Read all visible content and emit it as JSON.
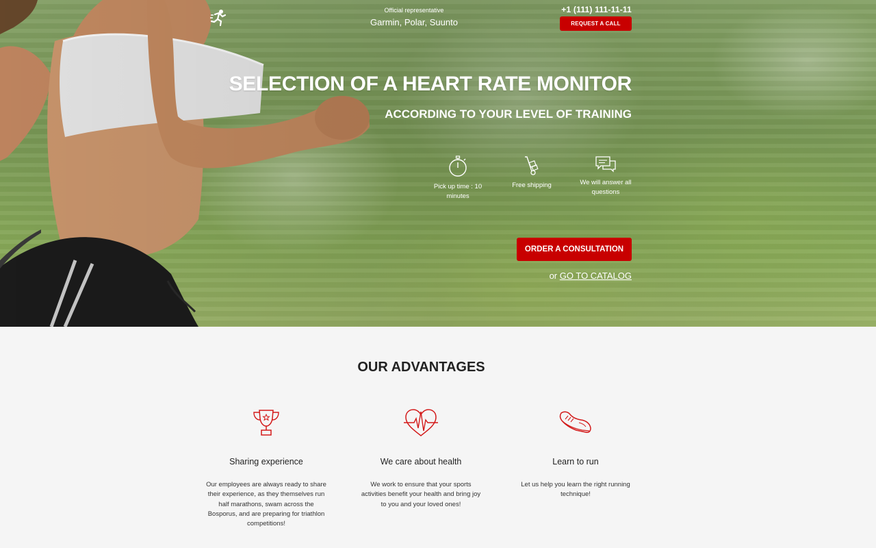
{
  "header": {
    "logo_icon": "runner-logo-icon",
    "representative_label": "Official representative",
    "brands": "Garmin, Polar, Suunto",
    "phone": "+1 (111) 111-11-11",
    "request_call_label": "Request a call"
  },
  "hero": {
    "title": "SELECTION OF A HEART RATE MONITOR",
    "subtitle": "ACCORDING TO YOUR LEVEL OF TRAINING",
    "features": [
      {
        "icon": "stopwatch-icon",
        "label": "Pick up time : 10 minutes"
      },
      {
        "icon": "hand-truck-icon",
        "label": "Free shipping"
      },
      {
        "icon": "chat-bubbles-icon",
        "label": "We will answer all questions"
      }
    ],
    "order_label": "Order a consultation",
    "or_label": "or",
    "catalog_label": "Go to catalog"
  },
  "advantages": {
    "title": "OUR ADVANTAGES",
    "items": [
      {
        "icon": "trophy-icon",
        "title": "Sharing experience",
        "text": "Our employees are always ready to share their experience, as they themselves run half marathons, swam across the Bosporus, and are preparing for triathlon competitions!"
      },
      {
        "icon": "heart-pulse-icon",
        "title": "We care about health",
        "text": "We work to ensure that your sports activities benefit your health and bring joy to you and your loved ones!"
      },
      {
        "icon": "running-shoe-icon",
        "title": "Learn to run",
        "text": "Let us help you learn the right running technique!"
      }
    ]
  },
  "colors": {
    "accent": "#c80000",
    "background": "#f5f5f5",
    "hero_green": "#8aa86a"
  }
}
